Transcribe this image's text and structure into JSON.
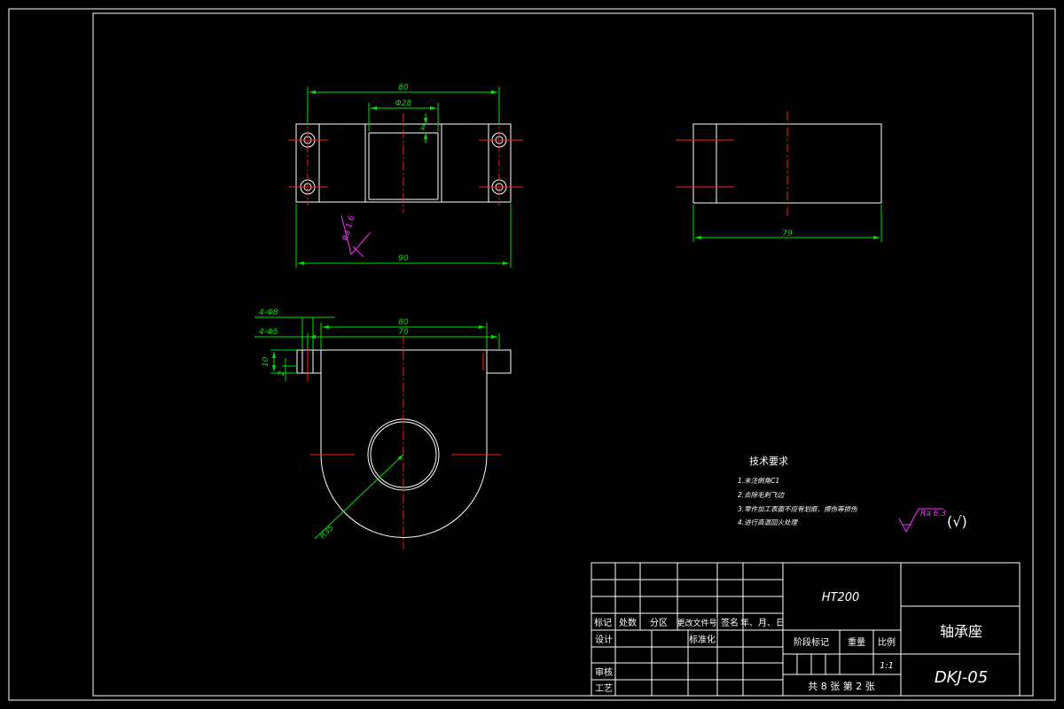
{
  "drawing": {
    "dimensions": {
      "top_width": "80",
      "bore_dia": "Φ28",
      "groove_depth": "4",
      "total_width": "90",
      "side_length": "79",
      "hole_large": "4-Φ8",
      "hole_small": "4-Φ5",
      "front_width": "80",
      "hole_spacing": "70",
      "flange_height": "10",
      "counterbore_depth": "2",
      "radius": "R35"
    },
    "roughness_top": "Ra 1.6",
    "roughness_general": "Ra 6.3",
    "roughness_rest_mark": "(√)"
  },
  "tech_req": {
    "title": "技术要求",
    "items": [
      "1.未注倒角C1",
      "2.去除毛刺飞边",
      "3.零件加工表面不应有划痕、擦伤等损伤",
      "4.进行高温回火处理"
    ]
  },
  "title_block": {
    "material": "HT200",
    "part_name": "轴承座",
    "drawing_no": "DKJ-05",
    "scale": "1:1",
    "sheet_info": "共 8 张  第 2 张",
    "headers": [
      "标记",
      "处数",
      "分区",
      "更改文件号",
      "签名",
      "年、月、日"
    ],
    "design": "设计",
    "standardization": "标准化",
    "review": "审核",
    "process": "工艺",
    "stage_mark": "阶段标记",
    "weight": "重量",
    "scale_label": "比例"
  },
  "colors": {
    "outline": "#ffffff",
    "dimension": "#00e000",
    "centerline": "#ff2020",
    "roughness": "#ff30ff"
  }
}
